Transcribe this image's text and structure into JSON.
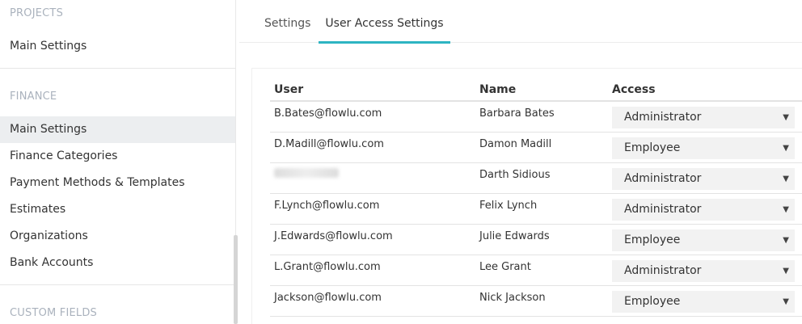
{
  "sidebar": {
    "sections": [
      {
        "title": "PROJECTS",
        "items": [
          "Main Settings"
        ]
      },
      {
        "title": "FINANCE",
        "items": [
          "Main Settings",
          "Finance Categories",
          "Payment Methods & Templates",
          "Estimates",
          "Organizations",
          "Bank Accounts"
        ]
      },
      {
        "title": "CUSTOM FIELDS",
        "items": []
      }
    ],
    "active_item": "Main Settings (Finance)"
  },
  "tabs": [
    {
      "label": "Settings",
      "active": false
    },
    {
      "label": "User Access Settings",
      "active": true
    }
  ],
  "table": {
    "columns": [
      "User",
      "Name",
      "Access"
    ],
    "rows": [
      {
        "user": "B.Bates@flowlu.com",
        "name": "Barbara Bates",
        "access": "Administrator"
      },
      {
        "user": "D.Madill@flowlu.com",
        "name": "Damon Madill",
        "access": "Employee"
      },
      {
        "user": "",
        "name": "Darth Sidious",
        "access": "Administrator"
      },
      {
        "user": "F.Lynch@flowlu.com",
        "name": "Felix Lynch",
        "access": "Administrator"
      },
      {
        "user": "J.Edwards@flowlu.com",
        "name": "Julie Edwards",
        "access": "Employee"
      },
      {
        "user": "L.Grant@flowlu.com",
        "name": "Lee Grant",
        "access": "Administrator"
      },
      {
        "user": "Jackson@flowlu.com",
        "name": "Nick Jackson",
        "access": "Employee"
      }
    ]
  },
  "colors": {
    "accent": "#2db4c2",
    "active_bg": "#eceef0",
    "section_title": "#aab2bd"
  }
}
